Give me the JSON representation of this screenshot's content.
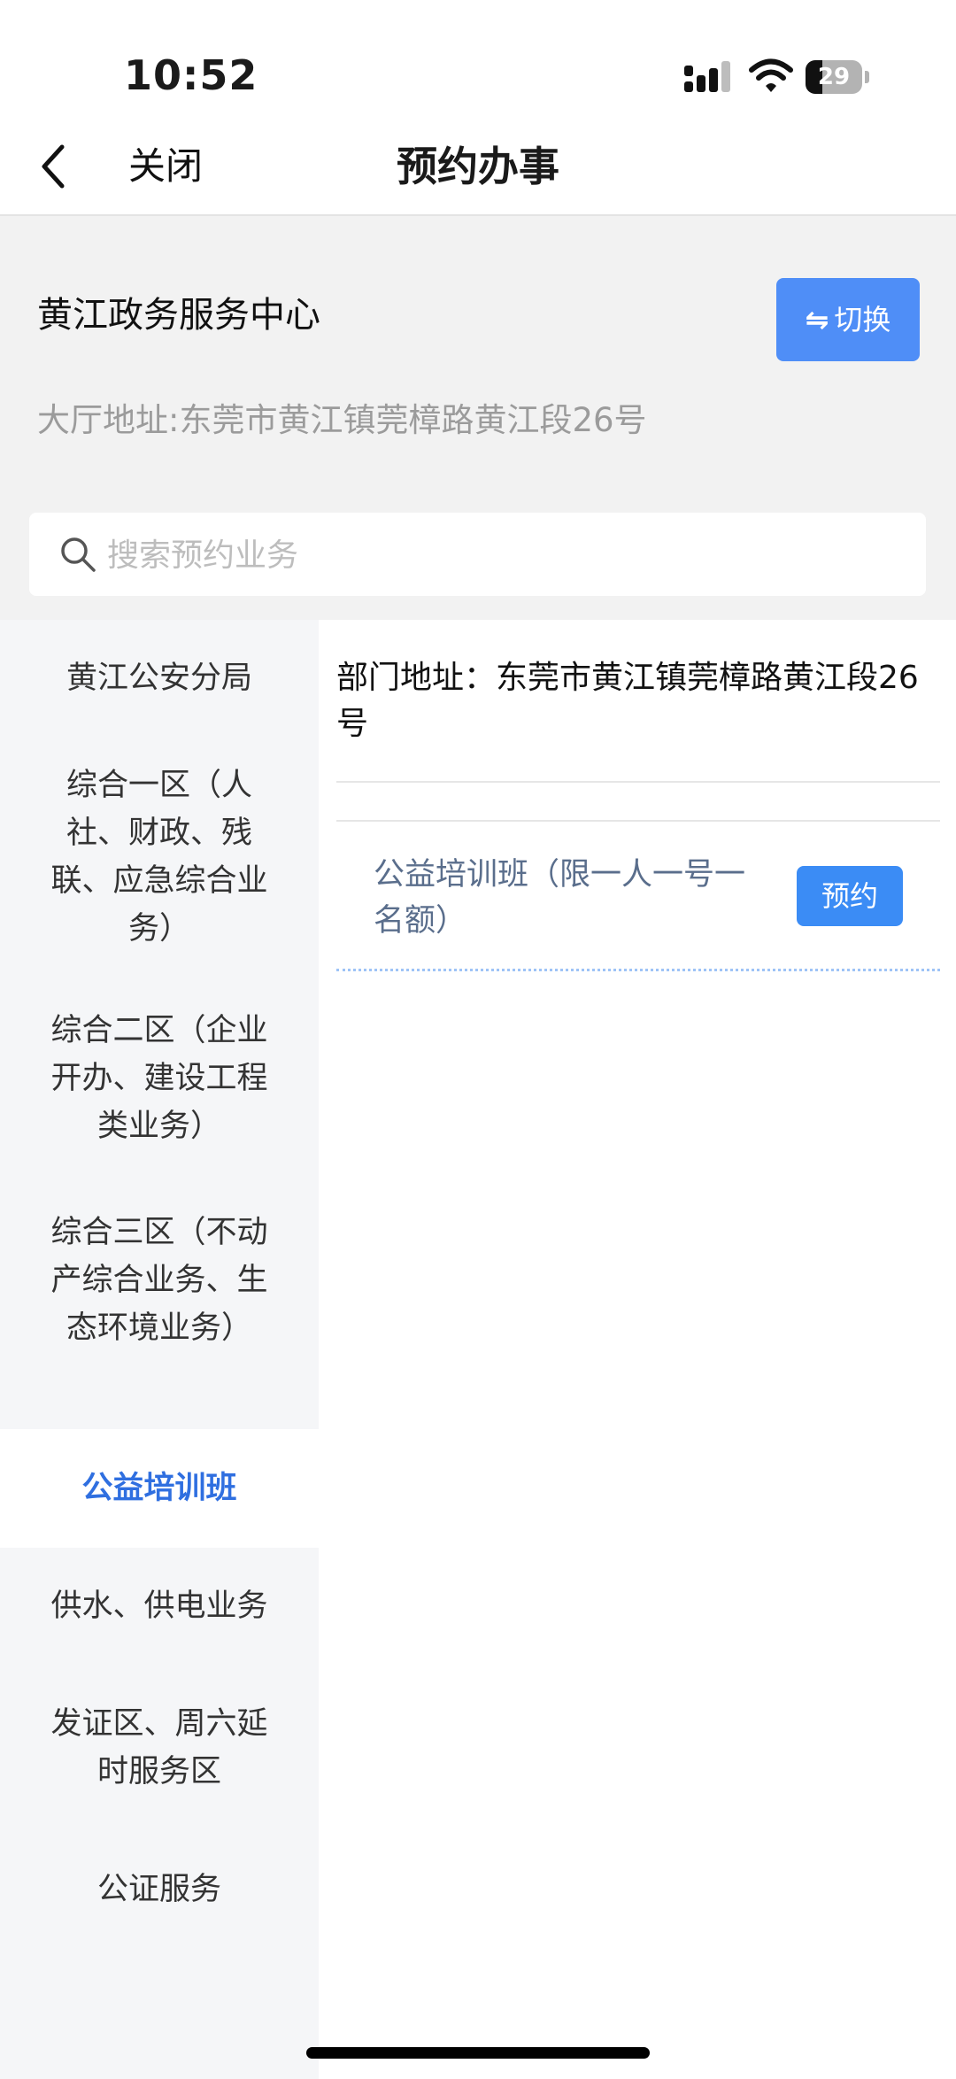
{
  "status_bar": {
    "time": "10:52",
    "battery_level": "29",
    "battery_fraction": 0.29
  },
  "nav": {
    "back_icon": "chevron-left-icon",
    "close_label": "关闭",
    "title": "预约办事"
  },
  "center": {
    "name": "黄江政务服务中心",
    "switch_label": "切换",
    "switch_icon": "⇋",
    "address": "大厅地址:东莞市黄江镇莞樟路黄江段26号"
  },
  "search": {
    "placeholder": "搜索预约业务",
    "value": ""
  },
  "sidebar": {
    "active_index": 4,
    "items": [
      {
        "label": "黄江公安分局"
      },
      {
        "label": "综合一区（人社、财政、残联、应急综合业务）"
      },
      {
        "label": "综合二区（企业开办、建设工程类业务）"
      },
      {
        "label": "综合三区（不动产综合业务、生态环境业务）"
      },
      {
        "label": "公益培训班"
      },
      {
        "label": "供水、供电业务"
      },
      {
        "label": "发证区、周六延时服务区"
      },
      {
        "label": "公证服务"
      }
    ]
  },
  "content": {
    "dept_address": "部门地址：东莞市黄江镇莞樟路黄江段26号",
    "services": [
      {
        "name": "公益培训班（限一人一号一名额）",
        "button_label": "预约"
      }
    ]
  },
  "colors": {
    "accent": "#4f8ef7",
    "active_text": "#2f6fe0",
    "book_button": "#3b8cf5",
    "service_text": "#5a6e8c"
  }
}
